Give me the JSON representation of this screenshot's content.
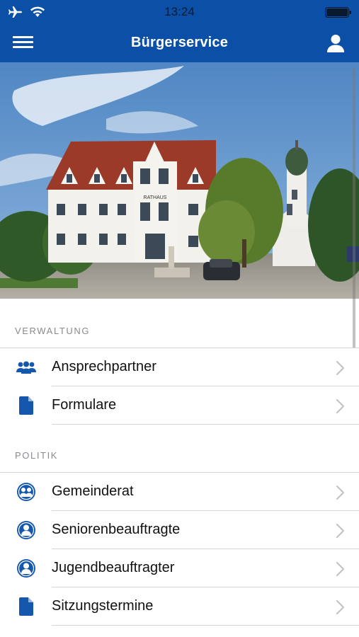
{
  "status_bar": {
    "time": "13:24"
  },
  "nav": {
    "title": "Bürgerservice"
  },
  "hero": {
    "sign_text": "RATHAUS"
  },
  "sections": [
    {
      "header": "VERWALTUNG",
      "items": [
        {
          "label": "Ansprechpartner",
          "icon": "people-group-icon"
        },
        {
          "label": "Formulare",
          "icon": "document-icon"
        }
      ]
    },
    {
      "header": "POLITIK",
      "items": [
        {
          "label": "Gemeinderat",
          "icon": "people-circle-icon"
        },
        {
          "label": "Seniorenbeauftragte",
          "icon": "person-circle-icon"
        },
        {
          "label": "Jugendbeauftragter",
          "icon": "person-circle-icon"
        },
        {
          "label": "Sitzungstermine",
          "icon": "document-icon"
        }
      ]
    }
  ],
  "colors": {
    "brand": "#0b4fa6",
    "icon": "#1457ac",
    "separator": "#d6d6d9",
    "section_text": "#8a8a8e"
  }
}
